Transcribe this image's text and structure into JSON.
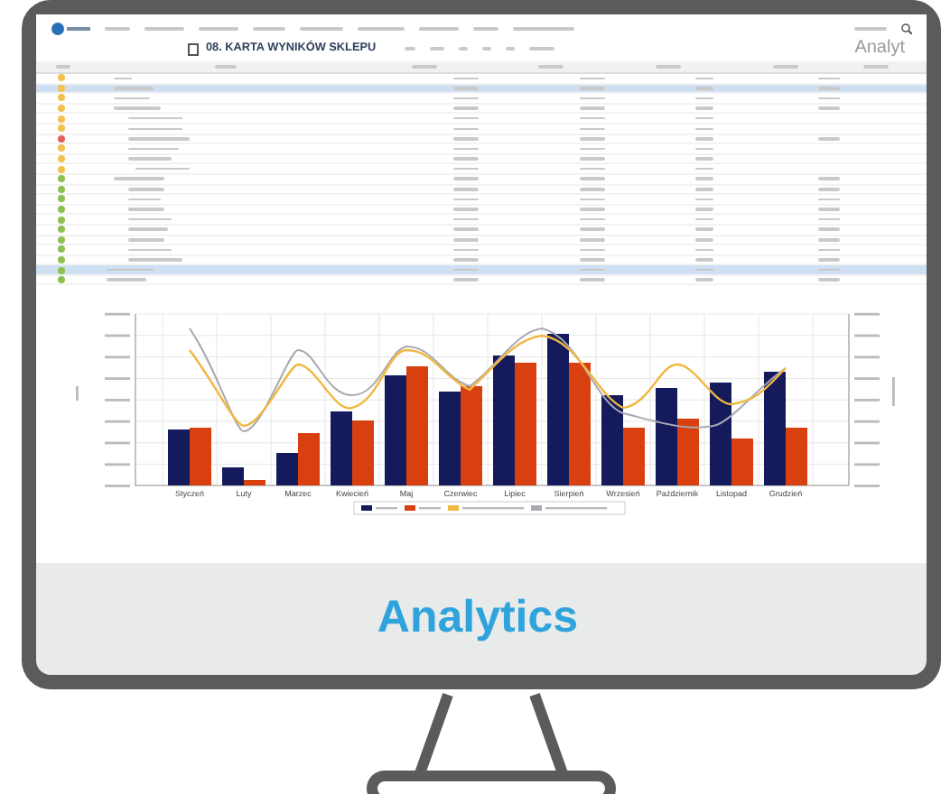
{
  "screen": {
    "page_title": "08. KARTA WYNIKÓW SKLEPU",
    "heading": "Analyt"
  },
  "table": {
    "rows": [
      {
        "color": "#f2c14e",
        "selected": false
      },
      {
        "color": "#f2c14e",
        "selected": true
      },
      {
        "color": "#f2c14e",
        "selected": false
      },
      {
        "color": "#f2c14e",
        "selected": false
      },
      {
        "color": "#f2c14e",
        "selected": false
      },
      {
        "color": "#f2c14e",
        "selected": false
      },
      {
        "color": "#e06060",
        "selected": false
      },
      {
        "color": "#f2c14e",
        "selected": false
      },
      {
        "color": "#f2c14e",
        "selected": false
      },
      {
        "color": "#f2c14e",
        "selected": false
      },
      {
        "color": "#8cc152",
        "selected": false
      },
      {
        "color": "#8cc152",
        "selected": false
      },
      {
        "color": "#8cc152",
        "selected": false
      },
      {
        "color": "#8cc152",
        "selected": false
      },
      {
        "color": "#8cc152",
        "selected": false
      },
      {
        "color": "#8cc152",
        "selected": false
      },
      {
        "color": "#8cc152",
        "selected": false
      },
      {
        "color": "#8cc152",
        "selected": false
      },
      {
        "color": "#8cc152",
        "selected": false
      },
      {
        "color": "#8cc152",
        "selected": true
      },
      {
        "color": "#8cc152",
        "selected": false
      }
    ]
  },
  "chart": {
    "categories": [
      "Styczeń",
      "Luty",
      "Marzec",
      "Kwiecień",
      "Maj",
      "Czerwiec",
      "Lipiec",
      "Sierpień",
      "Wrzesień",
      "Październik",
      "Listopad",
      "Grudzień"
    ]
  },
  "caption": "Analytics"
}
